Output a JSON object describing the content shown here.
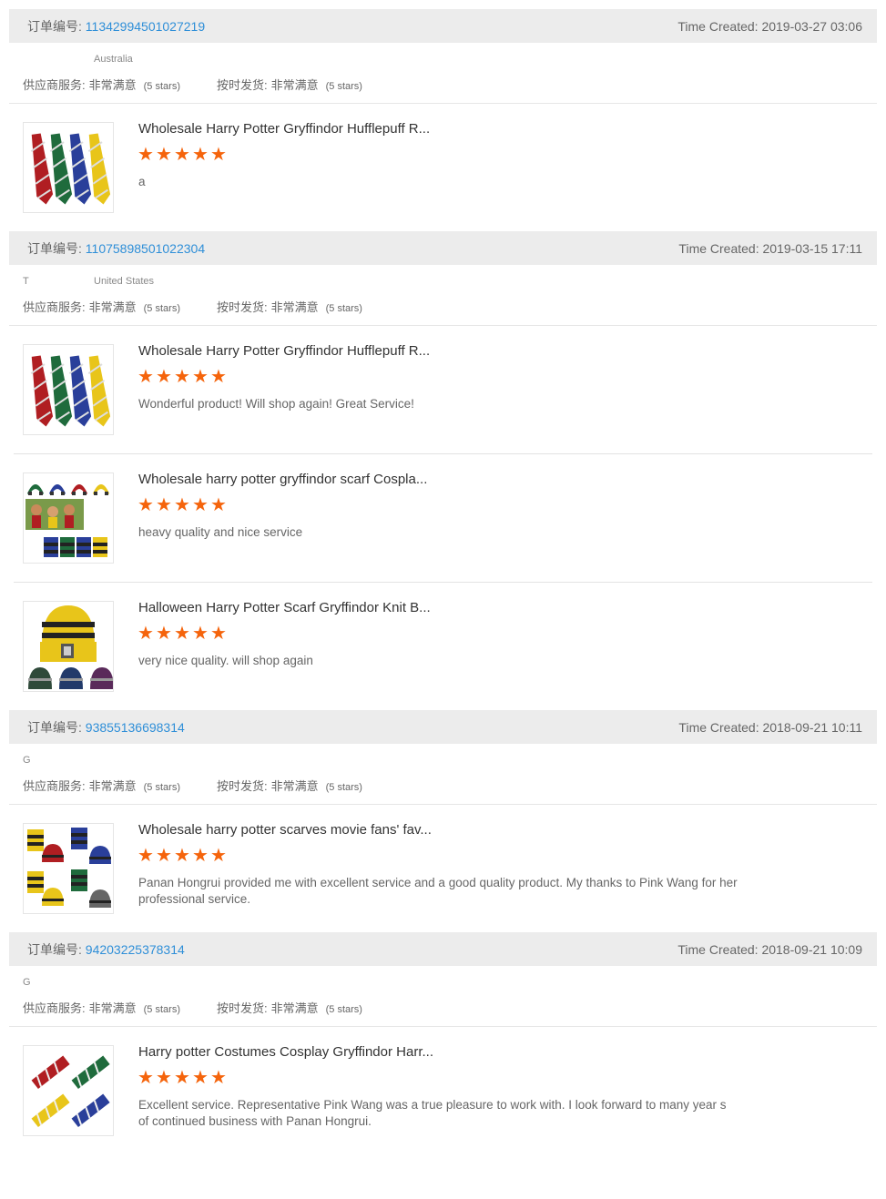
{
  "orders": [
    {
      "order_label": "订单编号:",
      "order_no": "11342994501027219",
      "time_label": "Time Created:",
      "time": "2019-03-27 03:06",
      "buyer_name": "",
      "buyer_country": "Australia",
      "supplier_label": "供应商服务:",
      "supplier_value": "非常满意",
      "supplier_stars": "(5 stars)",
      "ship_label": "按时发货:",
      "ship_value": "非常满意",
      "ship_stars": "(5 stars)",
      "items": [
        {
          "title": "Wholesale Harry Potter Gryffindor Hufflepuff R...",
          "rating": 5,
          "review": "a",
          "image": "ties-icon"
        }
      ]
    },
    {
      "order_label": "订单编号:",
      "order_no": "11075898501022304",
      "time_label": "Time Created:",
      "time": "2019-03-15 17:11",
      "buyer_name": "T",
      "buyer_country": "United States",
      "supplier_label": "供应商服务:",
      "supplier_value": "非常满意",
      "supplier_stars": "(5 stars)",
      "ship_label": "按时发货:",
      "ship_value": "非常满意",
      "ship_stars": "(5 stars)",
      "items": [
        {
          "title": "Wholesale Harry Potter Gryffindor Hufflepuff R...",
          "rating": 5,
          "review": "Wonderful product! Will shop again! Great Service!",
          "image": "ties-icon"
        },
        {
          "title": "Wholesale harry potter gryffindor scarf Cospla...",
          "rating": 5,
          "review": "heavy quality and nice service",
          "image": "scarves-icon"
        },
        {
          "title": "Halloween Harry Potter Scarf Gryffindor Knit B...",
          "rating": 5,
          "review": "very nice quality. will shop again",
          "image": "beanie-icon"
        }
      ]
    },
    {
      "order_label": "订单编号:",
      "order_no": "93855136698314",
      "time_label": "Time Created:",
      "time": "2018-09-21 10:11",
      "buyer_name": "G",
      "buyer_country": "",
      "supplier_label": "供应商服务:",
      "supplier_value": "非常满意",
      "supplier_stars": "(5 stars)",
      "ship_label": "按时发货:",
      "ship_value": "非常满意",
      "ship_stars": "(5 stars)",
      "items": [
        {
          "title": "Wholesale harry potter scarves movie fans' fav...",
          "rating": 5,
          "review": "Panan Hongrui provided me with excellent service and a good quality product.  My thanks to Pink Wang for her professional service.",
          "image": "hats-scarves-icon"
        }
      ]
    },
    {
      "order_label": "订单编号:",
      "order_no": "94203225378314",
      "time_label": "Time Created:",
      "time": "2018-09-21 10:09",
      "buyer_name": "G",
      "buyer_country": "",
      "supplier_label": "供应商服务:",
      "supplier_value": "非常满意",
      "supplier_stars": "(5 stars)",
      "ship_label": "按时发货:",
      "ship_value": "非常满意",
      "ship_stars": "(5 stars)",
      "items": [
        {
          "title": "Harry potter Costumes Cosplay Gryffindor Harr...",
          "rating": 5,
          "review": "Excellent service.  Representative Pink Wang was a true pleasure to work with.  I look forward to many year s of continued business with Panan Hongrui.",
          "image": "ties-diagonal-icon"
        }
      ]
    }
  ],
  "colors": {
    "star": "#f5640c",
    "order_link": "#2f8fd8",
    "header_bg": "#ececec",
    "red_house": "#b01e22",
    "green_house": "#1f6b3c",
    "blue_house": "#2a3f9a",
    "yellow_house": "#e8c51a"
  }
}
